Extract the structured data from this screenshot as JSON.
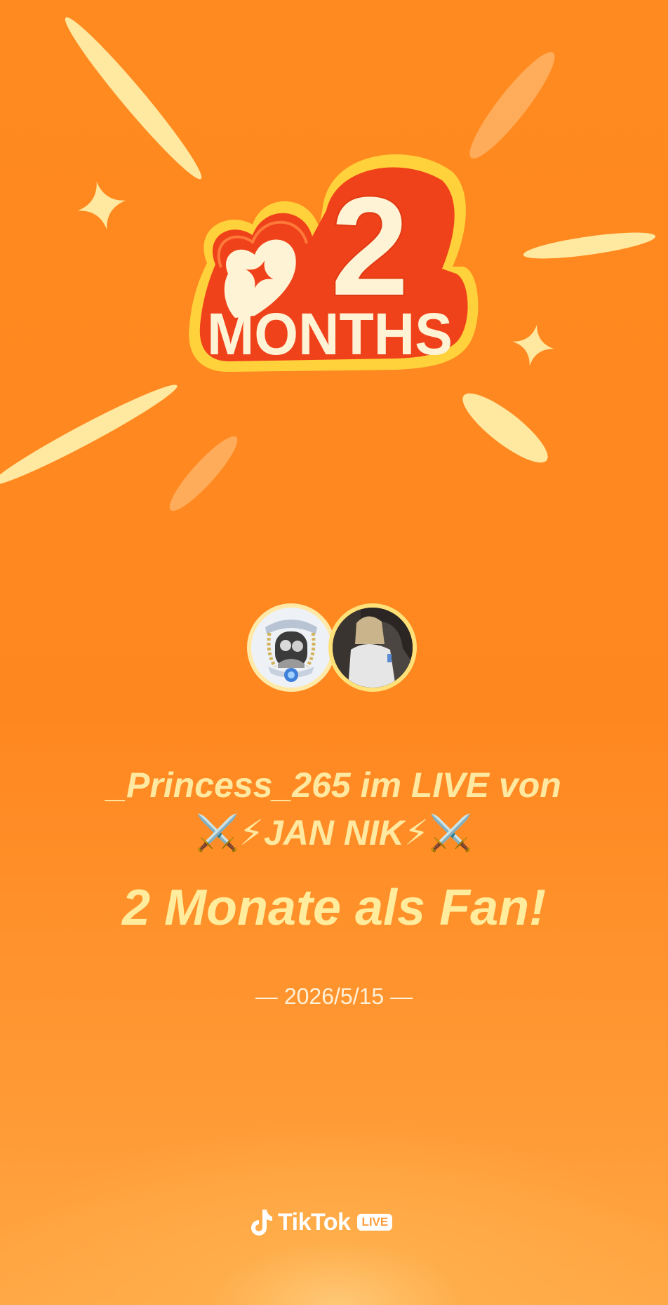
{
  "badge": {
    "number": "2",
    "word": "MONTHS"
  },
  "message": {
    "line1": "_Princess_265 im LIVE von",
    "line2_prefix": "⚔️⚡",
    "line2_name": "JAN NIK",
    "line2_suffix": "⚡⚔️",
    "headline": "2 Monate als Fan!"
  },
  "date": "— 2026/5/15 —",
  "brand": {
    "name": "TikTok",
    "tag": "LIVE"
  },
  "colors": {
    "background": "#ff8a1f",
    "text_accent": "#ffe9a0",
    "badge_red": "#f0421a",
    "badge_yellow": "#ffd23c"
  },
  "icons": {
    "logo": "tiktok-note-icon",
    "badge_star": "sparkle-icon"
  }
}
